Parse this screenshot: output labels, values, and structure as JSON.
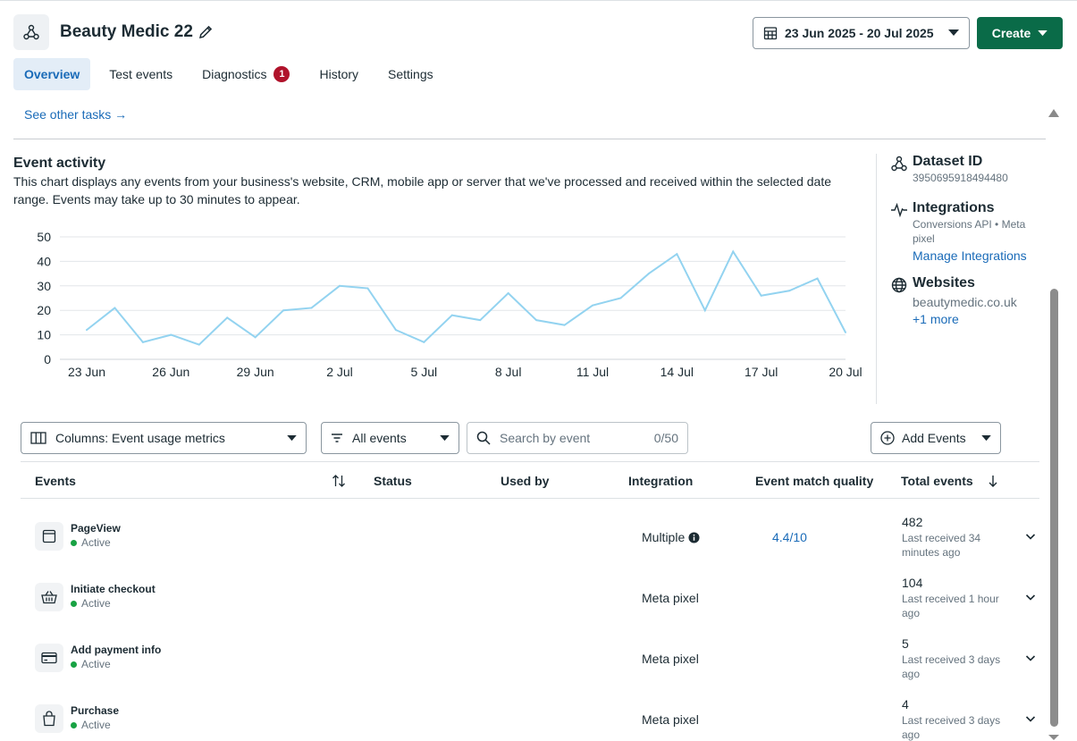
{
  "header": {
    "title": "Beauty Medic 22",
    "date_range": "23 Jun 2025 - 20 Jul 2025",
    "create_label": "Create"
  },
  "tabs": [
    {
      "label": "Overview",
      "active": true
    },
    {
      "label": "Test events"
    },
    {
      "label": "Diagnostics",
      "badge": "1"
    },
    {
      "label": "History"
    },
    {
      "label": "Settings"
    }
  ],
  "see_other_tasks": "See other tasks →",
  "event_activity": {
    "title": "Event activity",
    "description": "This chart displays any events from your business's website, CRM, mobile app or server that we've processed and received within the selected date range. Events may take up to 30 minutes to appear."
  },
  "chart_data": {
    "type": "line",
    "x_tick_labels": [
      "23 Jun",
      "26 Jun",
      "29 Jun",
      "2 Jul",
      "5 Jul",
      "8 Jul",
      "11 Jul",
      "14 Jul",
      "17 Jul",
      "20 Jul"
    ],
    "y_ticks": [
      0,
      10,
      20,
      30,
      40,
      50
    ],
    "ylim": [
      0,
      50
    ],
    "x": [
      "23 Jun",
      "24 Jun",
      "25 Jun",
      "26 Jun",
      "27 Jun",
      "28 Jun",
      "29 Jun",
      "30 Jun",
      "1 Jul",
      "2 Jul",
      "3 Jul",
      "4 Jul",
      "5 Jul",
      "6 Jul",
      "7 Jul",
      "8 Jul",
      "9 Jul",
      "10 Jul",
      "11 Jul",
      "12 Jul",
      "13 Jul",
      "14 Jul",
      "15 Jul",
      "16 Jul",
      "17 Jul",
      "18 Jul",
      "19 Jul",
      "20 Jul"
    ],
    "values": [
      12,
      21,
      7,
      10,
      6,
      17,
      9,
      20,
      21,
      30,
      29,
      12,
      7,
      18,
      16,
      27,
      16,
      14,
      22,
      25,
      35,
      43,
      20,
      44,
      26,
      28,
      33,
      11
    ],
    "color": "#93d3f0",
    "grid": true
  },
  "sidebar": {
    "dataset_title": "Dataset ID",
    "dataset_id": "3950695918494480",
    "integrations_title": "Integrations",
    "integrations_sub": "Conversions API • Meta pixel",
    "manage_link": "Manage Integrations",
    "websites_title": "Websites",
    "website": "beautymedic.co.uk",
    "more_link": "+1 more"
  },
  "filters": {
    "columns_label": "Columns: Event usage metrics",
    "events_filter_label": "All events",
    "search_placeholder": "Search by event",
    "search_count": "0/50",
    "add_events_label": "Add Events"
  },
  "table": {
    "headers": {
      "events": "Events",
      "status": "Status",
      "used_by": "Used by",
      "integration": "Integration",
      "emq": "Event match quality",
      "total": "Total events"
    },
    "rows": [
      {
        "name": "PageView",
        "status": "Active",
        "integration": "Multiple",
        "emq": "4.4/10",
        "total": "482",
        "last": "Last received 34 minutes ago",
        "icon": "browser-window-icon"
      },
      {
        "name": "Initiate checkout",
        "status": "Active",
        "integration": "Meta pixel",
        "emq": "",
        "total": "104",
        "last": "Last received 1 hour ago",
        "icon": "basket-icon"
      },
      {
        "name": "Add payment info",
        "status": "Active",
        "integration": "Meta pixel",
        "emq": "",
        "total": "5",
        "last": "Last received 3 days ago",
        "icon": "credit-card-icon"
      },
      {
        "name": "Purchase",
        "status": "Active",
        "integration": "Meta pixel",
        "emq": "",
        "total": "4",
        "last": "Last received 3 days ago",
        "icon": "shopping-bag-icon"
      }
    ]
  },
  "colors": {
    "accent": "#1a6bb8",
    "create_bg": "#0a6b48",
    "active_dot": "#18a243",
    "badge": "#b0132b"
  }
}
